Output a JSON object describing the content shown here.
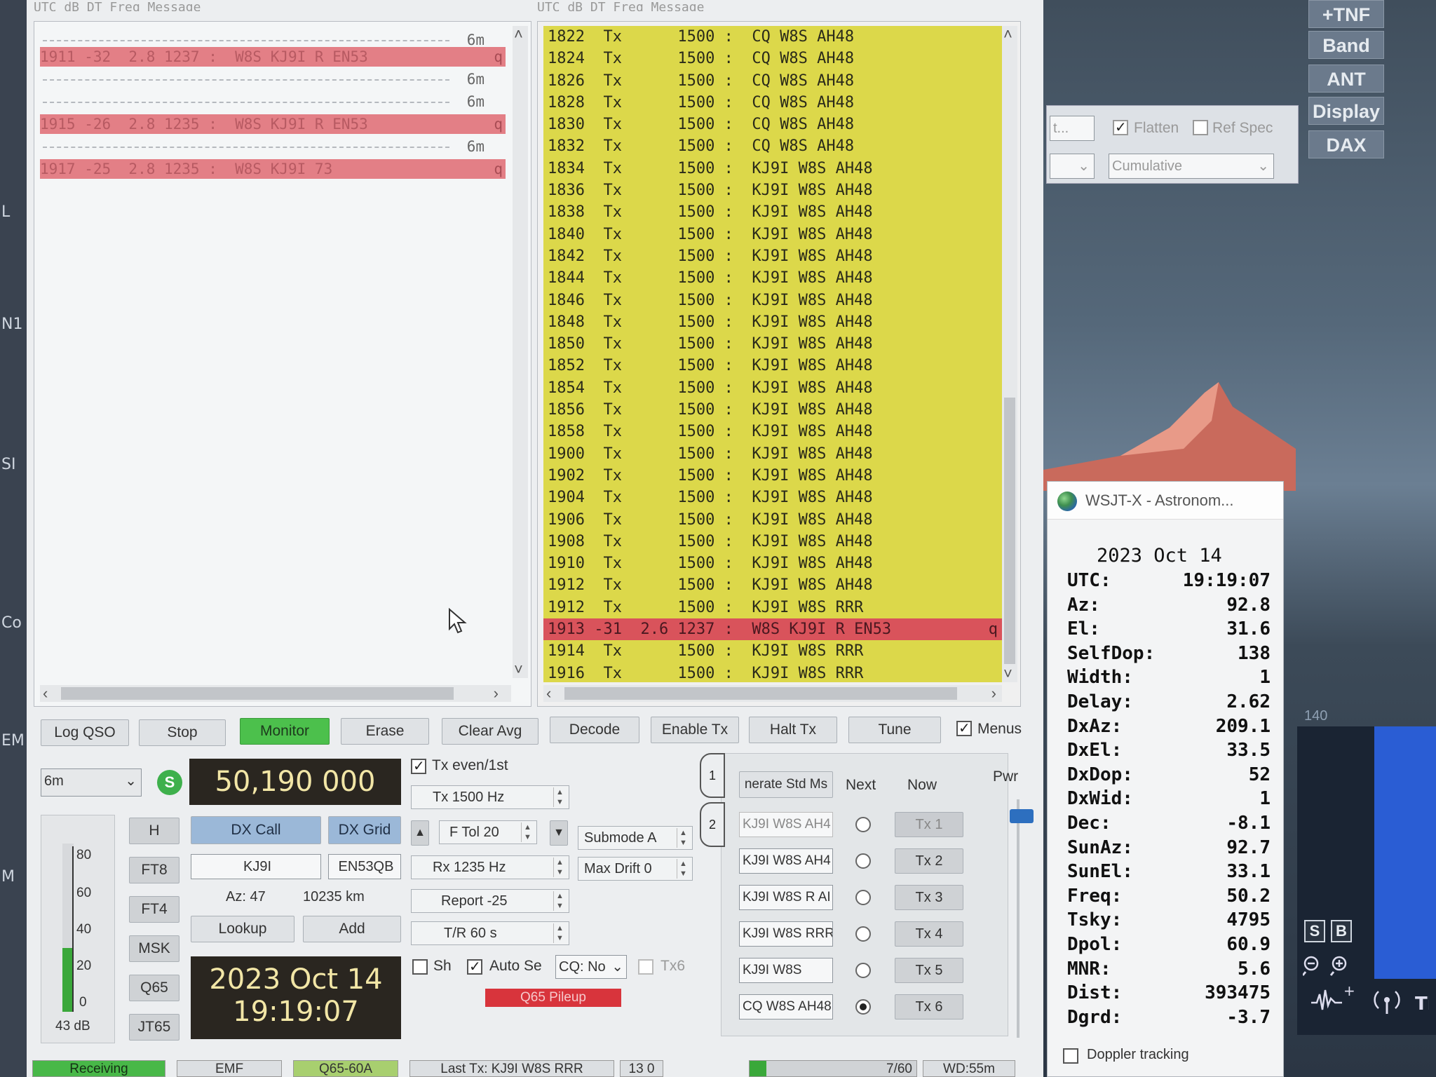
{
  "left_strip": {
    "labels": [
      "L",
      "N1",
      "SI",
      "Co",
      "EM",
      "M"
    ]
  },
  "left_pane": {
    "header": "UTC   dB   DT Freq    Message",
    "rows": [
      {
        "kind": "sep",
        "band": "6m"
      },
      {
        "kind": "hit",
        "text": "1911 -32  2.8 1237 :  W8S KJ9I R EN53",
        "flag": "q"
      },
      {
        "kind": "sep",
        "band": "6m"
      },
      {
        "kind": "sep",
        "band": "6m"
      },
      {
        "kind": "hit",
        "text": "1915 -26  2.8 1235 :  W8S KJ9I R EN53",
        "flag": "q"
      },
      {
        "kind": "sep",
        "band": "6m"
      },
      {
        "kind": "hit",
        "text": "1917 -25  2.8 1235 :  W8S KJ9I 73",
        "flag": "q"
      }
    ]
  },
  "right_pane": {
    "header": "UTC   dB   DT Freq    Message",
    "rows": [
      {
        "t": "1822  Tx      1500 :  CQ W8S AH48"
      },
      {
        "t": "1824  Tx      1500 :  CQ W8S AH48"
      },
      {
        "t": "1826  Tx      1500 :  CQ W8S AH48"
      },
      {
        "t": "1828  Tx      1500 :  CQ W8S AH48"
      },
      {
        "t": "1830  Tx      1500 :  CQ W8S AH48"
      },
      {
        "t": "1832  Tx      1500 :  CQ W8S AH48"
      },
      {
        "t": "1834  Tx      1500 :  KJ9I W8S AH48"
      },
      {
        "t": "1836  Tx      1500 :  KJ9I W8S AH48"
      },
      {
        "t": "1838  Tx      1500 :  KJ9I W8S AH48"
      },
      {
        "t": "1840  Tx      1500 :  KJ9I W8S AH48"
      },
      {
        "t": "1842  Tx      1500 :  KJ9I W8S AH48"
      },
      {
        "t": "1844  Tx      1500 :  KJ9I W8S AH48"
      },
      {
        "t": "1846  Tx      1500 :  KJ9I W8S AH48"
      },
      {
        "t": "1848  Tx      1500 :  KJ9I W8S AH48"
      },
      {
        "t": "1850  Tx      1500 :  KJ9I W8S AH48"
      },
      {
        "t": "1852  Tx      1500 :  KJ9I W8S AH48"
      },
      {
        "t": "1854  Tx      1500 :  KJ9I W8S AH48"
      },
      {
        "t": "1856  Tx      1500 :  KJ9I W8S AH48"
      },
      {
        "t": "1858  Tx      1500 :  KJ9I W8S AH48"
      },
      {
        "t": "1900  Tx      1500 :  KJ9I W8S AH48"
      },
      {
        "t": "1902  Tx      1500 :  KJ9I W8S AH48"
      },
      {
        "t": "1904  Tx      1500 :  KJ9I W8S AH48"
      },
      {
        "t": "1906  Tx      1500 :  KJ9I W8S AH48"
      },
      {
        "t": "1908  Tx      1500 :  KJ9I W8S AH48"
      },
      {
        "t": "1910  Tx      1500 :  KJ9I W8S AH48"
      },
      {
        "t": "1912  Tx      1500 :  KJ9I W8S AH48"
      },
      {
        "t": "1912  Tx      1500 :  KJ9I W8S RRR"
      },
      {
        "t": "1913 -31  2.6 1237 :  W8S KJ9I R EN53",
        "decode": true,
        "flag": "q"
      },
      {
        "t": "1914  Tx      1500 :  KJ9I W8S RRR"
      },
      {
        "t": "1916  Tx      1500 :  KJ9I W8S RRR"
      }
    ]
  },
  "buttons": {
    "log_qso": "Log QSO",
    "stop": "Stop",
    "monitor": "Monitor",
    "erase": "Erase",
    "clear_avg": "Clear Avg",
    "decode": "Decode",
    "enable_tx": "Enable Tx",
    "halt_tx": "Halt Tx",
    "tune": "Tune",
    "menus": "Menus"
  },
  "controls": {
    "band": "6m",
    "s_label": "S",
    "frequency": "50,190 000",
    "tx_even": "Tx even/1st",
    "tx_freq": "Tx  1500  Hz",
    "ftol": "F Tol  20",
    "rx_freq": "Rx  1235  Hz",
    "report": "Report -25",
    "tr": "T/R  60  s",
    "submode": "Submode A",
    "max_drift": "Max Drift  0",
    "sh": "Sh",
    "auto_seq": "Auto Se",
    "cq": "CQ: No",
    "tx6_chk": "Tx6",
    "q65_pileup": "Q65 Pileup",
    "h": "H",
    "ft8": "FT8",
    "ft4": "FT4",
    "msk": "MSK",
    "q65": "Q65",
    "jt65": "JT65",
    "dx_call_label": "DX Call",
    "dx_grid_label": "DX Grid",
    "dx_call": "KJ9I",
    "dx_grid": "EN53QB",
    "az": "Az: 47",
    "dist": "10235 km",
    "lookup": "Lookup",
    "add": "Add",
    "date": "2023 Oct 14",
    "time": "19:19:07",
    "meter": {
      "ticks": [
        "80",
        "60",
        "40",
        "20",
        "0"
      ],
      "level_db": "43 dB",
      "level": 0.38
    },
    "tab1": "1",
    "tab2": "2",
    "gen_std": "nerate Std Ms",
    "next": "Next",
    "now": "Now",
    "pwr": "Pwr",
    "tx_msgs": [
      "KJ9I W8S AH4",
      "KJ9I W8S AH4",
      "KJ9I W8S R AI",
      "KJ9I W8S RRR",
      "KJ9I W8S",
      "CQ W8S AH48"
    ],
    "tx_btns": [
      "Tx 1",
      "Tx 2",
      "Tx 3",
      "Tx 4",
      "Tx 5",
      "Tx 6"
    ],
    "selected_next": 5
  },
  "status": {
    "receiving": "Receiving",
    "emf": "EMF",
    "mode": "Q65-60A",
    "last_tx": "Last Tx: KJ9I W8S RRR",
    "count": "13  0",
    "period": "7/60",
    "wd": "WD:55m"
  },
  "right_app": {
    "tnf": "+TNF",
    "band": "Band",
    "ant": "ANT",
    "display": "Display",
    "dax": "DAX",
    "flatten": "Flatten",
    "ref_spec": "Ref Spec",
    "cumulative": "Cumulative",
    "trunc": "t...",
    "s_btn": "S",
    "b_btn": "B",
    "scale_label": "140",
    "ti": "Ti"
  },
  "astro": {
    "title": "WSJT-X - Astronom...",
    "date": "2023 Oct 14",
    "rows": [
      {
        "k": "UTC:",
        "v": "19:19:07"
      },
      {
        "k": "Az:",
        "v": "92.8"
      },
      {
        "k": "El:",
        "v": "31.6"
      },
      {
        "k": "SelfDop:",
        "v": "138"
      },
      {
        "k": "Width:",
        "v": "1"
      },
      {
        "k": "Delay:",
        "v": "2.62"
      },
      {
        "k": "DxAz:",
        "v": "209.1"
      },
      {
        "k": "DxEl:",
        "v": "33.5"
      },
      {
        "k": "DxDop:",
        "v": "52"
      },
      {
        "k": "DxWid:",
        "v": "1"
      },
      {
        "k": "Dec:",
        "v": "-8.1"
      },
      {
        "k": "SunAz:",
        "v": "92.7"
      },
      {
        "k": "SunEl:",
        "v": "33.1"
      },
      {
        "k": "Freq:",
        "v": "50.2"
      },
      {
        "k": "Tsky:",
        "v": "4795"
      },
      {
        "k": "Dpol:",
        "v": "60.9"
      },
      {
        "k": "MNR:",
        "v": "5.6"
      },
      {
        "k": "Dist:",
        "v": "393475"
      },
      {
        "k": "Dgrd:",
        "v": "-3.7"
      }
    ],
    "doppler": "Doppler tracking"
  }
}
